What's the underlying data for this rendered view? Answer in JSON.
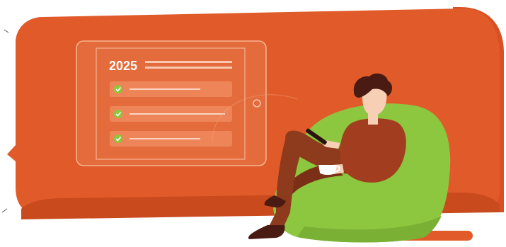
{
  "tablet": {
    "year": "2025",
    "checklist": [
      {
        "done": true
      },
      {
        "done": true
      },
      {
        "done": true
      }
    ]
  },
  "colors": {
    "banner": "#e15b2a",
    "banner_shadow": "#c94a1d",
    "sofa_back": "#d85126",
    "beanbag": "#8dc63f",
    "check_green": "#8dc63f",
    "shirt": "#a23d1f",
    "pants": "#8e3a1c",
    "hair": "#4a1b12",
    "skin": "#f6cfb5"
  }
}
